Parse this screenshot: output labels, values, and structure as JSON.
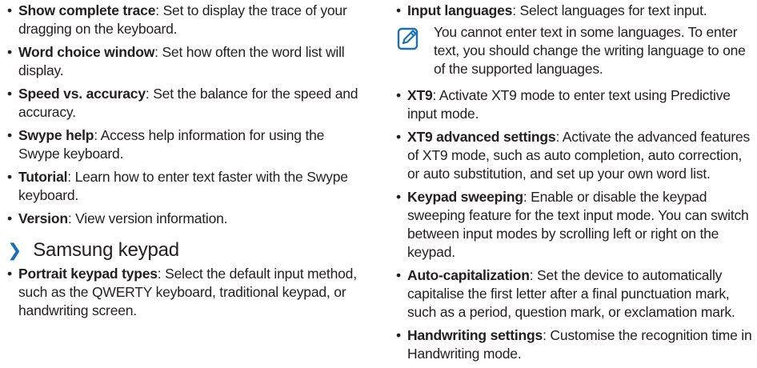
{
  "left_column": {
    "items_top": [
      {
        "term": "Show complete trace",
        "desc": ": Set to display the trace of your dragging on the keyboard."
      },
      {
        "term": "Word choice window",
        "desc": ": Set how often the word list will display."
      },
      {
        "term": "Speed vs. accuracy",
        "desc": ": Set the balance for the speed and accuracy."
      },
      {
        "term": "Swype help",
        "desc": ": Access help information for using the Swype keyboard."
      },
      {
        "term": "Tutorial",
        "desc": ": Learn how to enter text faster with the Swype keyboard."
      },
      {
        "term": "Version",
        "desc": ": View version information."
      }
    ],
    "section_heading": "Samsung keypad",
    "items_bottom": [
      {
        "term": "Portrait keypad types",
        "desc": ": Select the default input method, such as the QWERTY keyboard, traditional keypad, or handwriting screen."
      }
    ]
  },
  "right_column": {
    "first_item": {
      "term": "Input languages",
      "desc": ": Select languages for text input."
    },
    "note": {
      "icon": "note-pencil-icon",
      "text": "You cannot enter text in some languages. To enter text, you should change the writing language to one of the supported languages."
    },
    "items": [
      {
        "term": "XT9",
        "desc": ": Activate XT9 mode to enter text using Predictive input mode."
      },
      {
        "term": "XT9 advanced settings",
        "desc": ": Activate the advanced features of XT9 mode, such as auto completion, auto correction, or auto substitution, and set up your own word list."
      },
      {
        "term": "Keypad sweeping",
        "desc": ": Enable or disable the keypad sweeping feature for the text input mode. You can switch between input modes by scrolling left or right on the keypad."
      },
      {
        "term": "Auto-capitalization",
        "desc": ": Set the device to automatically capitalise the first letter after a final punctuation mark, such as a period, question mark, or exclamation mark."
      },
      {
        "term": "Handwriting settings",
        "desc": ": Customise the recognition time in Handwriting mode."
      }
    ]
  },
  "colors": {
    "accent": "#1a6fb5",
    "text": "#231f20"
  }
}
